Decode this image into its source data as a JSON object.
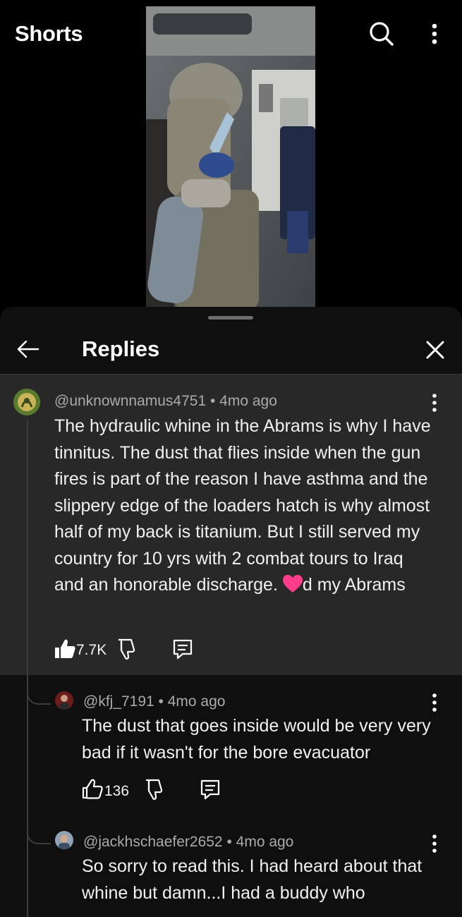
{
  "header": {
    "title": "Shorts",
    "search_icon": "search-icon",
    "more_icon": "more-vert-icon"
  },
  "video": {
    "icon": "video-frame"
  },
  "sheet": {
    "title": "Replies",
    "back_icon": "arrow-left-icon",
    "close_icon": "close-icon"
  },
  "comments": [
    {
      "author": "@unknownnamus4751",
      "age": "4mo ago",
      "text_before_heart": "The hydraulic whine in the Abrams is why I have tinnitus. The dust that flies inside when the gun fires is part of the reason I have asthma and the slippery edge of the loaders hatch is why almost half of my back is titanium. But I still served my country for 10 yrs with 2 combat tours to Iraq and an honorable discharge.",
      "text_after_heart": "d my Abrams",
      "likes": "7.7K"
    },
    {
      "author": "@kfj_7191",
      "age": "4mo ago",
      "text": "The dust that goes inside would be very very bad if it wasn't for the bore evacuator",
      "likes": "136"
    },
    {
      "author": "@jackhschaefer2652",
      "age": "4mo ago",
      "text": "So sorry to read this. I had heard about that whine but damn...I had a buddy who",
      "likes": ""
    }
  ],
  "colors": {
    "background": "#000000",
    "sheet": "#0f0f0f",
    "highlighted_comment": "#282828",
    "meta_text": "#aaaaaa",
    "heart": "#ff3d8b"
  }
}
